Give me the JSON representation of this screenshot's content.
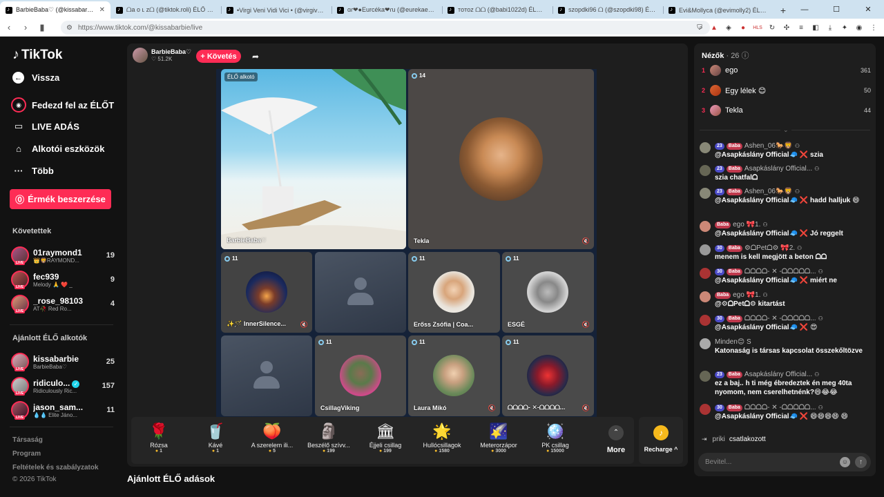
{
  "browser": {
    "tabs": [
      {
        "label": "BarbieBaba♡ (@kissabarbie)",
        "active": true
      },
      {
        "label": "ᗝa o ʟ ᴢᗝ (@tiktok.roli) ÉLŐ adás"
      },
      {
        "label": "•Virgi Veni Vidi Vici • (@virgivenividivici)"
      },
      {
        "label": "ɑɾ❤●Eurcéka❤ɾu (@eurekaeurcs)"
      },
      {
        "label": "тoтoz ᗝᗝ (@babi1022d) ÉLŐ adás"
      },
      {
        "label": "szopdki96 ᗝ (@szopdki98) ÉLŐ adás"
      },
      {
        "label": "Evi&Mollyca (@evimolly2) ÉLŐ adás"
      }
    ],
    "url": "https://www.tiktok.com/@kissabarbie/live"
  },
  "sidebar": {
    "logo": "TikTok",
    "back": "Vissza",
    "nav": [
      "Fedezd fel az ÉLŐT",
      "LIVE ADÁS",
      "Alkotói eszközök",
      "Több"
    ],
    "coins_button": "Érmék beszerzése",
    "following_title": "Követettek",
    "following": [
      {
        "name": "01raymond1",
        "sub": "👑🦁RAYMOND...",
        "count": "19"
      },
      {
        "name": "fec939",
        "sub": "Melody 🙏 ❤️ _",
        "count": "9"
      },
      {
        "name": "_rose_98103",
        "sub": "AT🥀 Red Ro...",
        "count": "4"
      }
    ],
    "recommended_title": "Ajánlott ÉLŐ alkotók",
    "recommended": [
      {
        "name": "kissabarbie",
        "sub": "BarbieBaba♡",
        "count": "25"
      },
      {
        "name": "ridiculo...",
        "sub": "Ridiculously Ric...",
        "count": "157",
        "verified": true
      },
      {
        "name": "jason_sam...",
        "sub": "💧💧 Elite Jáno...",
        "count": "11"
      }
    ],
    "footer": [
      "Társaság",
      "Program",
      "Feltételek és szabályzatok",
      "© 2026 TikTok"
    ]
  },
  "stream": {
    "host_name": "BarbieBaba♡",
    "host_likes": "♡ 51.2K",
    "follow": "+ Követés",
    "cells": [
      {
        "badge": "ÉLŐ alkotó",
        "name": "BarbieBaba♡"
      },
      {
        "badge": "14",
        "name": "Tekla"
      },
      {
        "badge": "11",
        "name": "✨🪄 InnerSilence..."
      },
      {
        "badge": "",
        "name": ""
      },
      {
        "badge": "11",
        "name": "Erőss Zsófia | Coa..."
      },
      {
        "badge": "11",
        "name": "ESGÉ"
      },
      {
        "badge": "",
        "name": ""
      },
      {
        "badge": "11",
        "name": "CsillagViking"
      },
      {
        "badge": "11",
        "name": "Laura Mikó"
      },
      {
        "badge": "11",
        "name": "ᗝᗝᗝᗝ- ✕-ᗝᗝᗝᗝ..."
      }
    ],
    "gifts": [
      {
        "icon": "🌹",
        "name": "Rózsa",
        "price": "1"
      },
      {
        "icon": "🥤",
        "name": "Kávé",
        "price": "1"
      },
      {
        "icon": "🍑",
        "name": "A szerelem ili...",
        "price": "5"
      },
      {
        "icon": "🗿",
        "name": "Beszélő szívv...",
        "price": "199"
      },
      {
        "icon": "🏛",
        "name": "Éjjeli csillag",
        "price": "199"
      },
      {
        "icon": "🌟",
        "name": "Hullócsillagok",
        "price": "1580"
      },
      {
        "icon": "🌠",
        "name": "Meterorzápor",
        "price": "3000"
      },
      {
        "icon": "🪩",
        "name": "PK csillag",
        "price": "15000"
      }
    ],
    "more": "More",
    "recharge": "Recharge ^"
  },
  "section_title": "Ajánlott ÉLŐ adások",
  "viewers": {
    "title": "Nézők",
    "count": "· 26",
    "top": [
      {
        "rank": "1",
        "name": "ego",
        "score": "361"
      },
      {
        "rank": "2",
        "name": "Egy lélek 😊",
        "score": "50"
      },
      {
        "rank": "3",
        "name": "Tekla",
        "score": "44"
      }
    ]
  },
  "chat": [
    {
      "lvl": "23",
      "badge": "Baba",
      "user": "Ashen_06🐎🦁",
      "text": "@Asapkáslány Official🧢 ❌ szia"
    },
    {
      "lvl": "23",
      "badge": "Baba",
      "user": "Asapkáslány Official...",
      "text": "szia chatfalᗝ"
    },
    {
      "lvl": "23",
      "badge": "Baba",
      "user": "Ashen_06🐎🦁",
      "text": "@Asapkáslány Official🧢 ❌ hadd halljuk 😄"
    },
    {
      "lvl": "",
      "badge": "Baba",
      "user": "ego 🎀1.",
      "text": "@Asapkáslány Official🧢 ❌ Jó reggelt"
    },
    {
      "lvl": "30",
      "badge": "Baba",
      "user": "⚙ᗝPetᗝ⚙ 🎀2.",
      "text": "menem is kell megjött a beton ᗝᗝ"
    },
    {
      "lvl": "30",
      "badge": "Baba",
      "user": "ᗝᗝᗝᗝ- ✕ -ᗝᗝᗝᗝᗝ...",
      "text": "@Asapkáslány Official🧢 ❌ miért ne"
    },
    {
      "lvl": "",
      "badge": "Baba",
      "user": "ego 🎀1.",
      "text": "@⚙ᗝPetᗝ⚙ kitartást"
    },
    {
      "lvl": "30",
      "badge": "Baba",
      "user": "ᗝᗝᗝᗝ- ✕ -ᗝᗝᗝᗝᗝ...",
      "text": "@Asapkáslány Official🧢 ❌ 😍"
    },
    {
      "lvl": "",
      "badge": "",
      "user": "Minden😊 S",
      "text": "Katonaság is társas kapcsolat összekőltözve"
    },
    {
      "lvl": "23",
      "badge": "Baba",
      "user": "Asapkáslány Official...",
      "text": "ez a baj.. h ti még ébredeztek én meg 40ta nyomom, nem cserelhetnénk?😄😂😂"
    },
    {
      "lvl": "30",
      "badge": "Baba",
      "user": "ᗝᗝᗝᗝ- ✕ -ᗝᗝᗝᗝᗝ...",
      "text": "@Asapkáslány Official🧢 ❌ 😄😄😄😄 😄"
    }
  ],
  "join": {
    "user": "priki",
    "text": "csatlakozott"
  },
  "input_placeholder": "Bevitel..."
}
